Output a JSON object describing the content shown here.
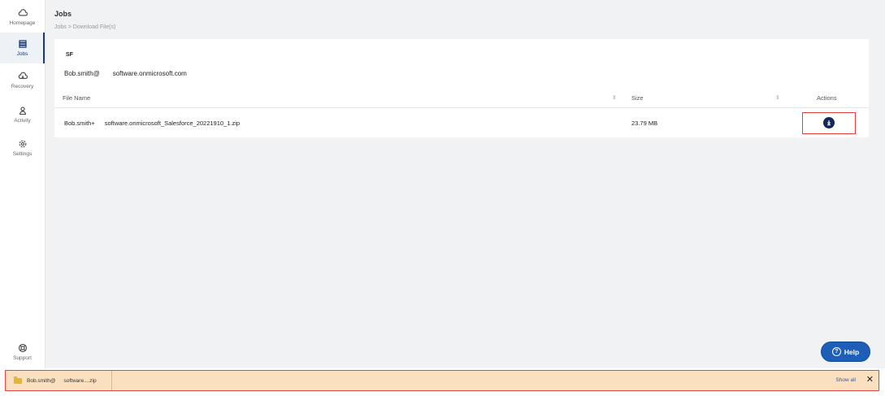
{
  "sidebar": {
    "items": [
      {
        "label": "Homepage",
        "icon": "cloud-icon"
      },
      {
        "label": "Jobs",
        "icon": "jobs-icon",
        "active": true
      },
      {
        "label": "Recovery",
        "icon": "recovery-icon"
      },
      {
        "label": "Activity",
        "icon": "activity-icon"
      },
      {
        "label": "Settings",
        "icon": "settings-icon"
      }
    ],
    "support": {
      "label": "Support",
      "icon": "support-icon"
    }
  },
  "header": {
    "title": "Jobs",
    "breadcrumb": "Jobs > Download File(s)"
  },
  "card": {
    "account_type": "SF",
    "email_user": "Bob.smith@",
    "email_domain": "software.onmicrosoft.com",
    "table": {
      "columns": [
        "File Name",
        "Size",
        "Actions"
      ],
      "sort_glyph": "⇕",
      "rows": [
        {
          "file_prefix": "Bob.smith+",
          "file_rest": "software.onmicrosoft_Salesforce_20221910_1.zip",
          "size": "23.79 MB"
        }
      ]
    }
  },
  "help": {
    "label": "Help",
    "q": "?"
  },
  "download_bar": {
    "file_part1": "Bob.smith@",
    "file_part2": "software....zip",
    "show_all": "Show all",
    "close": "✕"
  },
  "colors": {
    "accent": "#1d5fb8",
    "nav_active": "#1a3a7a",
    "highlight_border": "#e04040",
    "download_bar_bg": "#fbe0bf"
  }
}
